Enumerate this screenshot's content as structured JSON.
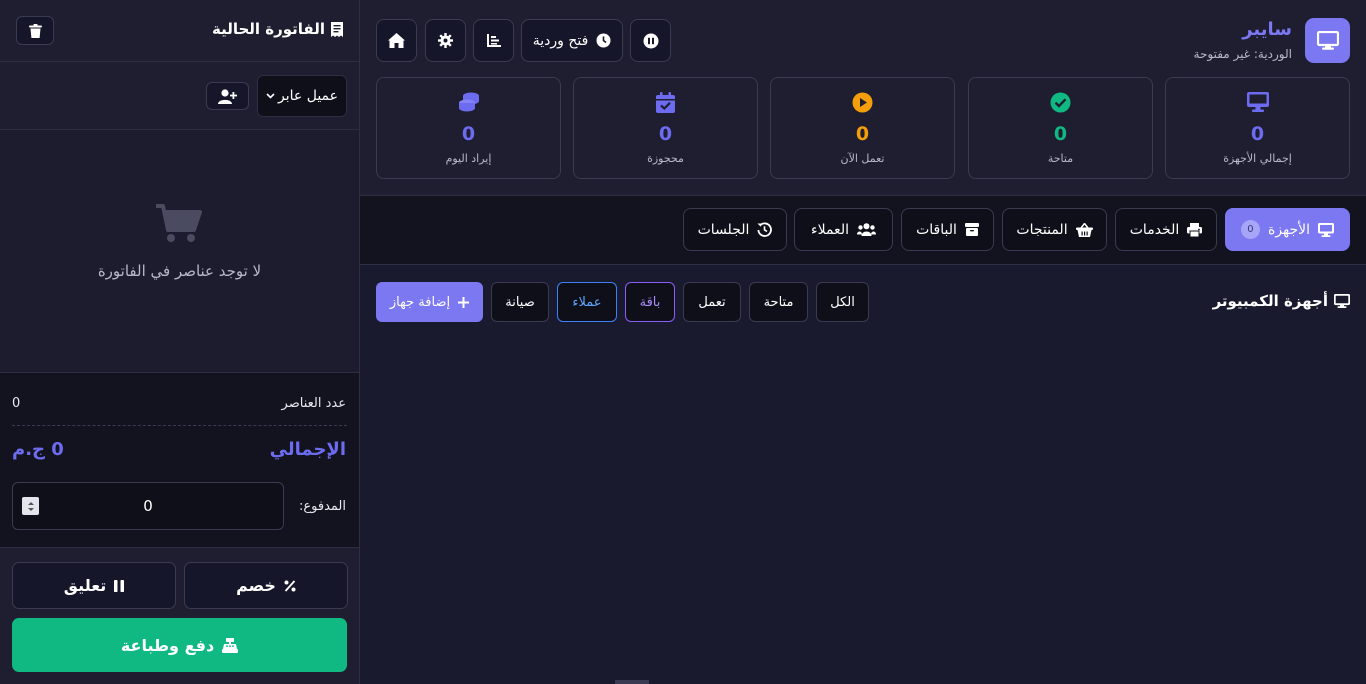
{
  "invoice": {
    "title": "الفاتورة الحالية",
    "customer_select": "عميل عابر",
    "empty_message": "لا توجد عناصر في الفاتورة",
    "items_count_label": "عدد العناصر",
    "items_count": "0",
    "total_label": "الإجمالي",
    "total_value": "0 ج.م",
    "paid_label": "المدفوع:",
    "paid_value": "0",
    "discount_label": "خصم",
    "suspend_label": "تعليق",
    "pay_print_label": "دفع وطباعة"
  },
  "header": {
    "brand_name": "سايبر",
    "shift_status": "الوردية: غير مفتوحة",
    "open_shift_label": "فتح وردية"
  },
  "stats": [
    {
      "label": "إجمالي الأجهزة",
      "value": "0",
      "color": "#6d6cf0",
      "icon": "monitor-icon"
    },
    {
      "label": "متاحة",
      "value": "0",
      "color": "#10b981",
      "icon": "check-circle-icon"
    },
    {
      "label": "تعمل الآن",
      "value": "0",
      "color": "#f59e0b",
      "icon": "play-circle-icon"
    },
    {
      "label": "محجوزة",
      "value": "0",
      "color": "#6d6cf0",
      "icon": "calendar-check-icon"
    },
    {
      "label": "إيراد اليوم",
      "value": "0",
      "color": "#6d6cf0",
      "icon": "coins-icon"
    }
  ],
  "tabs": [
    {
      "label": "الأجهزة",
      "count": "0",
      "icon": "desktop-icon",
      "active": true
    },
    {
      "label": "الخدمات",
      "icon": "printer-icon"
    },
    {
      "label": "المنتجات",
      "icon": "basket-icon"
    },
    {
      "label": "الباقات",
      "icon": "box-icon"
    },
    {
      "label": "العملاء",
      "icon": "users-icon"
    },
    {
      "label": "الجلسات",
      "icon": "history-icon"
    }
  ],
  "devices": {
    "section_title": "أجهزة الكمبيوتر",
    "filters": {
      "all": "الكل",
      "available": "متاحة",
      "running": "تعمل",
      "package": "باقة",
      "customers": "عملاء",
      "maintenance": "صيانة"
    },
    "add_device_label": "إضافة جهاز"
  },
  "colors": {
    "accent": "#7b78f2",
    "success": "#10b981",
    "warning": "#f59e0b",
    "customers_border": "#3b82f6",
    "package_border": "#8b5cf6"
  }
}
